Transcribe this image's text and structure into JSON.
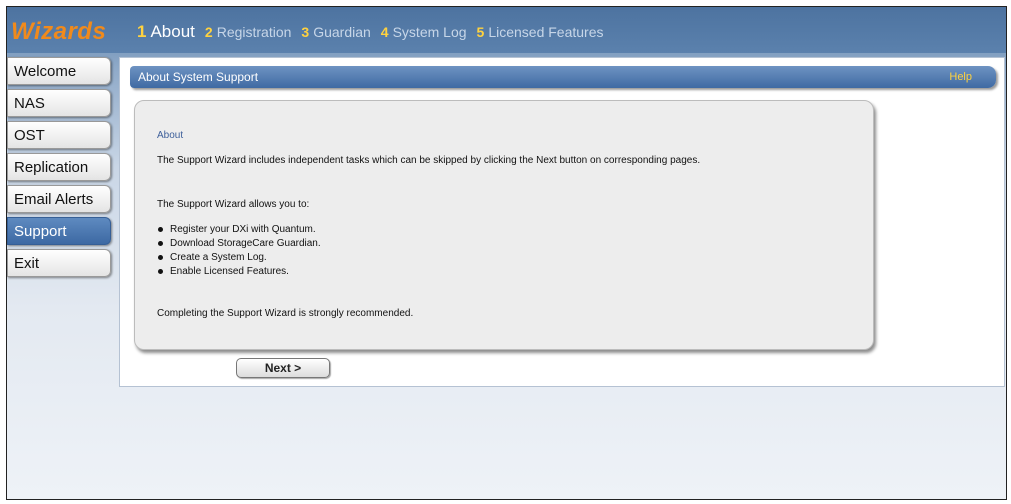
{
  "header": {
    "brand": "Wizards",
    "steps": [
      {
        "num": "1",
        "label": "About"
      },
      {
        "num": "2",
        "label": "Registration"
      },
      {
        "num": "3",
        "label": "Guardian"
      },
      {
        "num": "4",
        "label": "System Log"
      },
      {
        "num": "5",
        "label": "Licensed Features"
      }
    ],
    "active_step": 1
  },
  "sidebar": {
    "items": [
      {
        "label": "Welcome"
      },
      {
        "label": "NAS"
      },
      {
        "label": "OST"
      },
      {
        "label": "Replication"
      },
      {
        "label": "Email Alerts"
      },
      {
        "label": "Support"
      },
      {
        "label": "Exit"
      }
    ],
    "active_item": "Support"
  },
  "main": {
    "title": "About System Support",
    "help": "Help",
    "panel": {
      "heading": "About",
      "intro": "The Support Wizard includes independent tasks which can be skipped by clicking the Next button on corresponding pages.",
      "allows": "The Support Wizard allows you to:",
      "bullets": [
        "Register your DXi with Quantum.",
        "Download StorageCare Guardian.",
        "Create a System Log.",
        "Enable Licensed Features."
      ],
      "closing": "Completing the Support Wizard is strongly recommended."
    },
    "next_label": "Next >"
  },
  "colors": {
    "brand": "#f08a1c",
    "step_number": "#ffd23f",
    "header_bg": "#4d73a0",
    "active_nav": "#3d69a3",
    "help_link": "#ffd23f"
  }
}
